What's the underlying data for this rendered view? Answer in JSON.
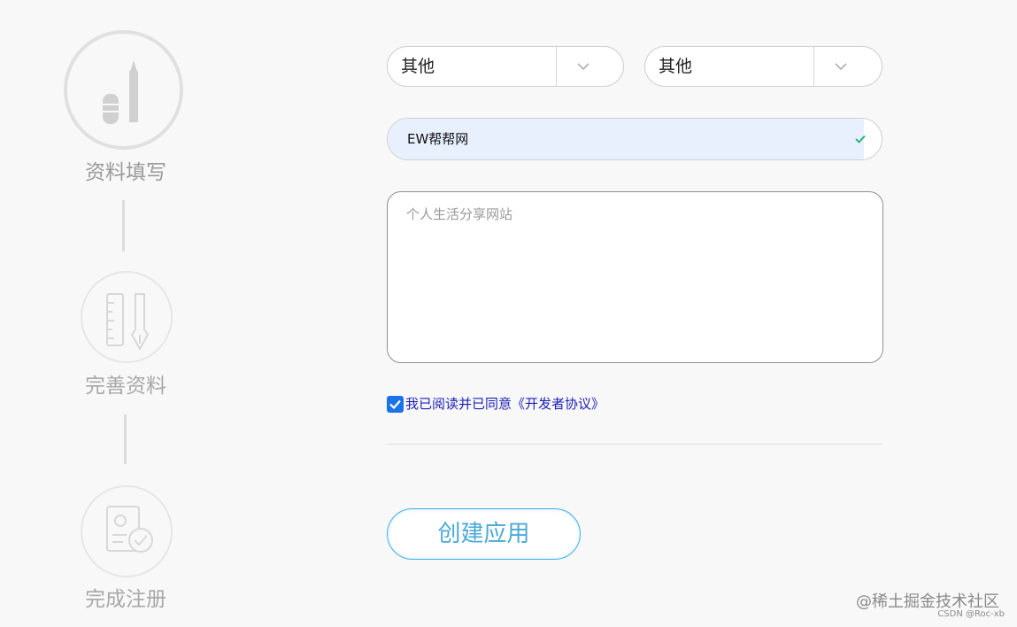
{
  "steps": [
    {
      "label": "资料填写",
      "state": "active",
      "icon": "pen-eraser-icon"
    },
    {
      "label": "完善资料",
      "state": "inactive",
      "icon": "ruler-pen-icon"
    },
    {
      "label": "完成注册",
      "state": "inactive",
      "icon": "document-check-icon"
    }
  ],
  "form": {
    "select_left": {
      "value": "其他"
    },
    "select_right": {
      "value": "其他"
    },
    "site_name": {
      "value": "EW帮帮网",
      "valid": true
    },
    "description": {
      "placeholder": "个人生活分享网站",
      "value": ""
    },
    "agreement": {
      "checked": true,
      "text": "我已阅读并已同意《开发者协议》"
    },
    "submit_label": "创建应用"
  },
  "watermark": {
    "main": "@稀土掘金技术社区",
    "sub": "CSDN @Roc-xb"
  },
  "colors": {
    "background": "#f8f8f8",
    "autofill": "#e8f0fe",
    "valid_check": "#1aae6f",
    "checkbox": "#1a73e8",
    "link_text": "#1f1fb8",
    "button_border": "#3cb0e6",
    "button_text": "#4aa9d6"
  }
}
